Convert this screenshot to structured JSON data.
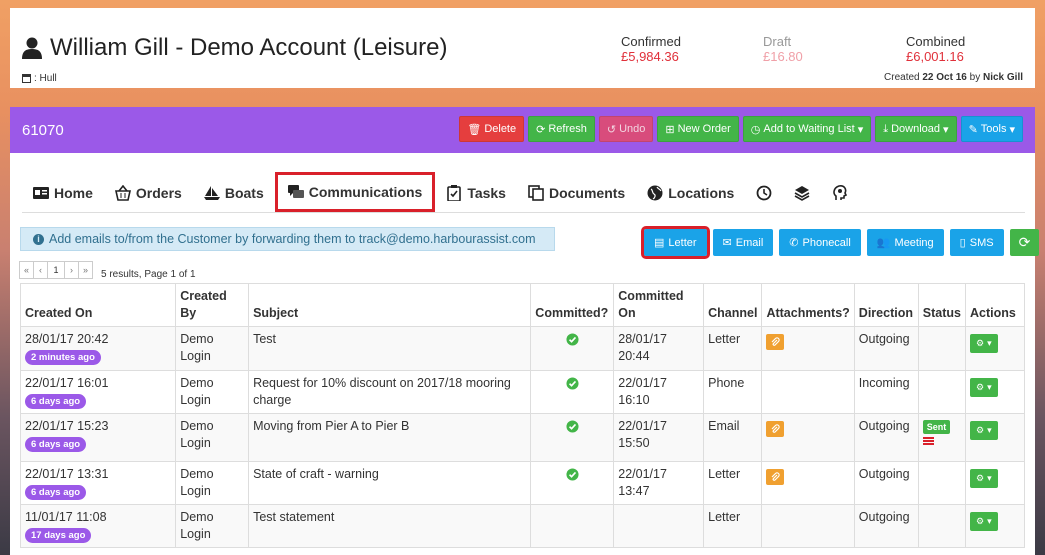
{
  "account": {
    "name": "William Gill - Demo Account (Leisure)",
    "location": ": Hull",
    "confirmed_label": "Confirmed",
    "confirmed_value": "£5,984.36",
    "draft_label": "Draft",
    "draft_value": "£16.80",
    "combined_label": "Combined",
    "combined_value": "£6,001.16",
    "created_prefix": "Created",
    "created_date": "22 Oct 16",
    "created_by_prefix": "by",
    "created_by": "Nick Gill",
    "number": "61070"
  },
  "toolbar": {
    "delete": "Delete",
    "refresh": "Refresh",
    "undo": "Undo",
    "new_order": "New Order",
    "waiting_list": "Add to Waiting List",
    "download": "Download",
    "tools": "Tools"
  },
  "tabs": {
    "home": "Home",
    "orders": "Orders",
    "boats": "Boats",
    "communications": "Communications",
    "tasks": "Tasks",
    "documents": "Documents",
    "locations": "Locations"
  },
  "info": {
    "text": "Add emails to/from the Customer by forwarding them to track@demo.harbourassist.com"
  },
  "comm_buttons": {
    "letter": "Letter",
    "email": "Email",
    "phonecall": "Phonecall",
    "meeting": "Meeting",
    "sms": "SMS"
  },
  "pager": {
    "first": "«",
    "prev": "‹",
    "page": "1",
    "next": "›",
    "last": "»",
    "summary": "5 results, Page 1 of 1"
  },
  "table": {
    "headers": {
      "created_on": "Created On",
      "created_by": "Created By",
      "subject": "Subject",
      "committed": "Committed?",
      "committed_on": "Committed On",
      "channel": "Channel",
      "attachments": "Attachments?",
      "direction": "Direction",
      "status": "Status",
      "actions": "Actions"
    },
    "rows": [
      {
        "created_on": "28/01/17 20:42",
        "ago": "2 minutes ago",
        "created_by": "Demo Login",
        "subject": "Test",
        "committed": true,
        "committed_on": "28/01/17 20:44",
        "channel": "Letter",
        "attachment": true,
        "direction": "Outgoing",
        "status": ""
      },
      {
        "created_on": "22/01/17 16:01",
        "ago": "6 days ago",
        "created_by": "Demo Login",
        "subject": "Request for 10% discount on 2017/18 mooring charge",
        "committed": true,
        "committed_on": "22/01/17 16:10",
        "channel": "Phone",
        "attachment": false,
        "direction": "Incoming",
        "status": ""
      },
      {
        "created_on": "22/01/17 15:23",
        "ago": "6 days ago",
        "created_by": "Demo Login",
        "subject": "Moving from Pier A to Pier B",
        "committed": true,
        "committed_on": "22/01/17 15:50",
        "channel": "Email",
        "attachment": true,
        "direction": "Outgoing",
        "status": "Sent"
      },
      {
        "created_on": "22/01/17 13:31",
        "ago": "6 days ago",
        "created_by": "Demo Login",
        "subject": "State of craft - warning",
        "committed": true,
        "committed_on": "22/01/17 13:47",
        "channel": "Letter",
        "attachment": true,
        "direction": "Outgoing",
        "status": ""
      },
      {
        "created_on": "11/01/17 11:08",
        "ago": "17 days ago",
        "created_by": "Demo Login",
        "subject": "Test statement",
        "committed": false,
        "committed_on": "",
        "channel": "Letter",
        "attachment": false,
        "direction": "Outgoing",
        "status": ""
      }
    ]
  },
  "colors": {
    "purple": "#9b59e8",
    "green": "#43b548",
    "red": "#e53e3e",
    "blue": "#1aa3e8",
    "highlight": "#d9202a"
  }
}
